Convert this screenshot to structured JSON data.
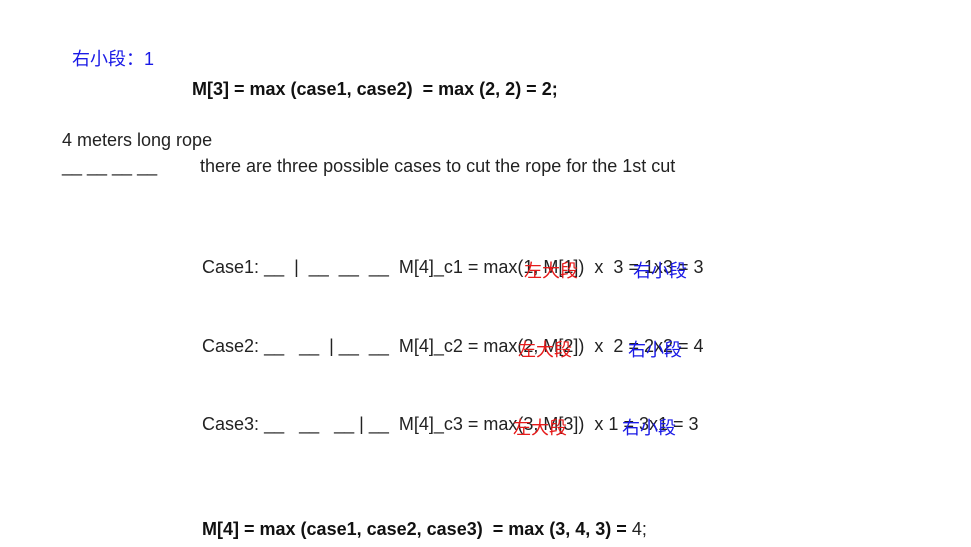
{
  "top_note": {
    "label": "右小段",
    "separator": "：",
    "value": "1"
  },
  "m3_result": "M[3] = max (case1, case2)  = max (2, 2) = 2;",
  "rope_intro": "4 meters long rope",
  "rope_segments": "__ __ __ __",
  "rope_description": "there are three possible cases to cut the rope for the 1st cut",
  "cases": [
    {
      "label": "Case1:",
      "cut_diagram": "__  |  __  __  __",
      "formula": "M[4]_c1 = max(1, M[1])  x  3 = 1x3 = 3",
      "left_label": "左大段",
      "right_label": "右小段"
    },
    {
      "label": "Case2:",
      "cut_diagram": "__   __  | __  __",
      "formula": "M[4]_c2 = max(2, M[2])  x  2 = 2x2 = 4",
      "left_label": "左大段",
      "right_label": "右小段"
    },
    {
      "label": "Case3:",
      "cut_diagram": "__   __   __ | __",
      "formula": "M[4]_c3 = max(3, M[3])  x 1 = 3x1 = 3",
      "left_label": "左大段",
      "right_label": "右小段"
    }
  ],
  "m4_result_bold": "M[4] = max (case1, case2, case3)  = max (3, 4, 3) =",
  "m4_result_value": "4;",
  "colors": {
    "blue": "#1a1ae6",
    "red": "#e61a1a",
    "text": "#222222"
  }
}
